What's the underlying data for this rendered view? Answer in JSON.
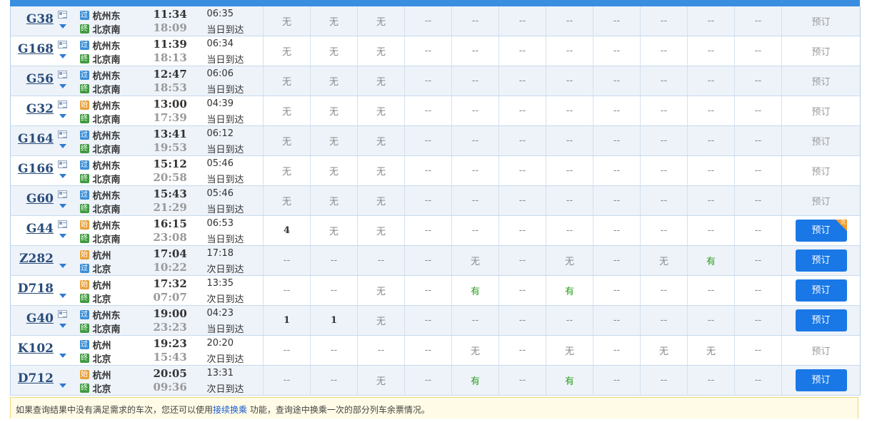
{
  "notice": {
    "before": "如果查询结果中没有满足需求的车次，您还可以使用",
    "link": "接续换乘",
    "after": " 功能，查询途中换乘一次的部分列车余票情况。"
  },
  "book_label": "预订",
  "dui_label": "兑",
  "badge_text": {
    "pass": "过",
    "start": "始",
    "end": "终"
  },
  "rows": [
    {
      "train": "G38",
      "card": true,
      "from_type": "pass",
      "from": "杭州东",
      "to_type": "end",
      "to": "北京南",
      "dep": "11:34",
      "arr": "18:09",
      "dur": "06:35",
      "day": "当日到达",
      "seats": [
        "无",
        "无",
        "无",
        "--",
        "--",
        "--",
        "--",
        "--",
        "--",
        "--",
        "--"
      ],
      "book": "disabled"
    },
    {
      "train": "G168",
      "card": true,
      "from_type": "pass",
      "from": "杭州东",
      "to_type": "end",
      "to": "北京南",
      "dep": "11:39",
      "arr": "18:13",
      "dur": "06:34",
      "day": "当日到达",
      "seats": [
        "无",
        "无",
        "无",
        "--",
        "--",
        "--",
        "--",
        "--",
        "--",
        "--",
        "--"
      ],
      "book": "disabled"
    },
    {
      "train": "G56",
      "card": true,
      "from_type": "pass",
      "from": "杭州东",
      "to_type": "end",
      "to": "北京南",
      "dep": "12:47",
      "arr": "18:53",
      "dur": "06:06",
      "day": "当日到达",
      "seats": [
        "无",
        "无",
        "无",
        "--",
        "--",
        "--",
        "--",
        "--",
        "--",
        "--",
        "--"
      ],
      "book": "disabled"
    },
    {
      "train": "G32",
      "card": true,
      "from_type": "start",
      "from": "杭州东",
      "to_type": "end",
      "to": "北京南",
      "dep": "13:00",
      "arr": "17:39",
      "dur": "04:39",
      "day": "当日到达",
      "seats": [
        "无",
        "无",
        "无",
        "--",
        "--",
        "--",
        "--",
        "--",
        "--",
        "--",
        "--"
      ],
      "book": "disabled"
    },
    {
      "train": "G164",
      "card": true,
      "from_type": "pass",
      "from": "杭州东",
      "to_type": "end",
      "to": "北京南",
      "dep": "13:41",
      "arr": "19:53",
      "dur": "06:12",
      "day": "当日到达",
      "seats": [
        "无",
        "无",
        "无",
        "--",
        "--",
        "--",
        "--",
        "--",
        "--",
        "--",
        "--"
      ],
      "book": "disabled"
    },
    {
      "train": "G166",
      "card": true,
      "from_type": "pass",
      "from": "杭州东",
      "to_type": "end",
      "to": "北京南",
      "dep": "15:12",
      "arr": "20:58",
      "dur": "05:46",
      "day": "当日到达",
      "seats": [
        "无",
        "无",
        "无",
        "--",
        "--",
        "--",
        "--",
        "--",
        "--",
        "--",
        "--"
      ],
      "book": "disabled"
    },
    {
      "train": "G60",
      "card": true,
      "from_type": "pass",
      "from": "杭州东",
      "to_type": "end",
      "to": "北京南",
      "dep": "15:43",
      "arr": "21:29",
      "dur": "05:46",
      "day": "当日到达",
      "seats": [
        "无",
        "无",
        "无",
        "--",
        "--",
        "--",
        "--",
        "--",
        "--",
        "--",
        "--"
      ],
      "book": "disabled"
    },
    {
      "train": "G44",
      "card": true,
      "from_type": "start",
      "from": "杭州东",
      "to_type": "end",
      "to": "北京南",
      "dep": "16:15",
      "arr": "23:08",
      "dur": "06:53",
      "day": "当日到达",
      "seats": [
        "4",
        "无",
        "无",
        "--",
        "--",
        "--",
        "--",
        "--",
        "--",
        "--",
        "--"
      ],
      "book": "active",
      "dui": true
    },
    {
      "train": "Z282",
      "card": false,
      "from_type": "start",
      "from": "杭州",
      "to_type": "pass",
      "to": "北京",
      "dep": "17:04",
      "arr": "10:22",
      "dur": "17:18",
      "day": "次日到达",
      "seats": [
        "--",
        "--",
        "--",
        "--",
        "无",
        "--",
        "无",
        "--",
        "无",
        "有",
        "--"
      ],
      "book": "active"
    },
    {
      "train": "D718",
      "card": false,
      "from_type": "start",
      "from": "杭州",
      "to_type": "end",
      "to": "北京",
      "dep": "17:32",
      "arr": "07:07",
      "dur": "13:35",
      "day": "次日到达",
      "seats": [
        "--",
        "--",
        "无",
        "--",
        "有",
        "--",
        "有",
        "--",
        "--",
        "--",
        "--"
      ],
      "book": "active"
    },
    {
      "train": "G40",
      "card": true,
      "from_type": "pass",
      "from": "杭州东",
      "to_type": "end",
      "to": "北京南",
      "dep": "19:00",
      "arr": "23:23",
      "dur": "04:23",
      "day": "当日到达",
      "seats": [
        "1",
        "1",
        "无",
        "--",
        "--",
        "--",
        "--",
        "--",
        "--",
        "--",
        "--"
      ],
      "book": "active"
    },
    {
      "train": "K102",
      "card": false,
      "from_type": "pass",
      "from": "杭州",
      "to_type": "end",
      "to": "北京",
      "dep": "19:23",
      "arr": "15:43",
      "dur": "20:20",
      "day": "次日到达",
      "seats": [
        "--",
        "--",
        "--",
        "--",
        "无",
        "--",
        "无",
        "--",
        "无",
        "无",
        "--"
      ],
      "book": "disabled"
    },
    {
      "train": "D712",
      "card": false,
      "from_type": "start",
      "from": "杭州",
      "to_type": "end",
      "to": "北京",
      "dep": "20:05",
      "arr": "09:36",
      "dur": "13:31",
      "day": "次日到达",
      "seats": [
        "--",
        "--",
        "无",
        "--",
        "有",
        "--",
        "有",
        "--",
        "--",
        "--",
        "--"
      ],
      "book": "active"
    }
  ]
}
